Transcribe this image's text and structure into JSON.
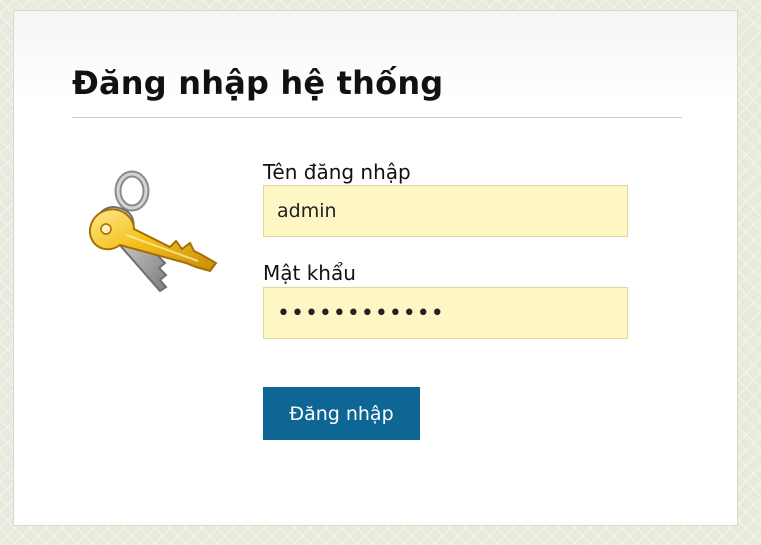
{
  "login": {
    "title": "Đăng nhập hệ thống",
    "icon": "keys-icon",
    "username": {
      "label": "Tên đăng nhập",
      "value": "admin"
    },
    "password": {
      "label": "Mật khẩu",
      "value": "adminpass123"
    },
    "submit_label": "Đăng nhập"
  },
  "colors": {
    "field_background": "#fff6c6",
    "button_background": "#0d6694",
    "button_text": "#ffffff",
    "page_background": "#e9e9dc"
  }
}
